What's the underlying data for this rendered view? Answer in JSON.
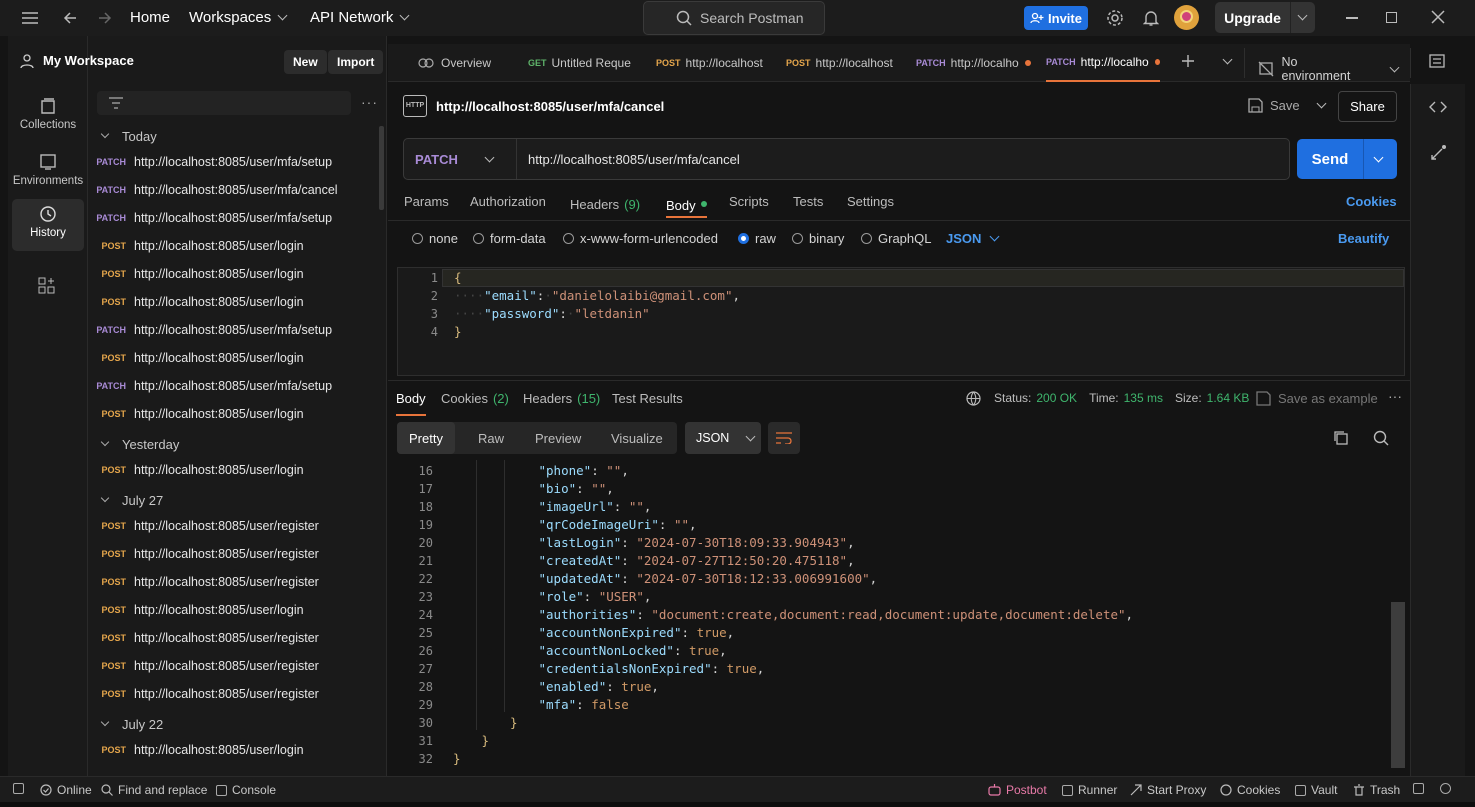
{
  "topbar": {
    "home": "Home",
    "workspaces": "Workspaces",
    "api_network": "API Network",
    "search_placeholder": "Search Postman",
    "invite": "Invite",
    "upgrade": "Upgrade"
  },
  "rail": {
    "collections": "Collections",
    "environments": "Environments",
    "history": "History"
  },
  "sidebar": {
    "workspace": "My Workspace",
    "new": "New",
    "import": "Import",
    "groups": [
      {
        "title": "Today",
        "items": [
          {
            "method": "PATCH",
            "url": "http://localhost:8085/user/mfa/setup"
          },
          {
            "method": "PATCH",
            "url": "http://localhost:8085/user/mfa/cancel"
          },
          {
            "method": "PATCH",
            "url": "http://localhost:8085/user/mfa/setup"
          },
          {
            "method": "POST",
            "url": "http://localhost:8085/user/login"
          },
          {
            "method": "POST",
            "url": "http://localhost:8085/user/login"
          },
          {
            "method": "POST",
            "url": "http://localhost:8085/user/login"
          },
          {
            "method": "PATCH",
            "url": "http://localhost:8085/user/mfa/setup"
          },
          {
            "method": "POST",
            "url": "http://localhost:8085/user/login"
          },
          {
            "method": "PATCH",
            "url": "http://localhost:8085/user/mfa/setup"
          },
          {
            "method": "POST",
            "url": "http://localhost:8085/user/login"
          }
        ]
      },
      {
        "title": "Yesterday",
        "items": [
          {
            "method": "POST",
            "url": "http://localhost:8085/user/login"
          }
        ]
      },
      {
        "title": "July 27",
        "items": [
          {
            "method": "POST",
            "url": "http://localhost:8085/user/register"
          },
          {
            "method": "POST",
            "url": "http://localhost:8085/user/register"
          },
          {
            "method": "POST",
            "url": "http://localhost:8085/user/register"
          },
          {
            "method": "POST",
            "url": "http://localhost:8085/user/login"
          },
          {
            "method": "POST",
            "url": "http://localhost:8085/user/register"
          },
          {
            "method": "POST",
            "url": "http://localhost:8085/user/register"
          },
          {
            "method": "POST",
            "url": "http://localhost:8085/user/register"
          }
        ]
      },
      {
        "title": "July 22",
        "items": [
          {
            "method": "POST",
            "url": "http://localhost:8085/user/login"
          }
        ]
      }
    ]
  },
  "tabs": [
    {
      "method": "",
      "label": "Overview"
    },
    {
      "method": "GET",
      "label": "Untitled Reques"
    },
    {
      "method": "POST",
      "label": "http://localhost"
    },
    {
      "method": "POST",
      "label": "http://localhost"
    },
    {
      "method": "PATCH",
      "label": "http://localho"
    },
    {
      "method": "PATCH",
      "label": "http://localho"
    }
  ],
  "environment": "No environment",
  "request": {
    "title": "http://localhost:8085/user/mfa/cancel",
    "save": "Save",
    "share": "Share",
    "method": "PATCH",
    "url": "http://localhost:8085/user/mfa/cancel",
    "send": "Send",
    "subtabs": {
      "params": "Params",
      "authorization": "Authorization",
      "headers": "Headers",
      "headers_count": "(9)",
      "body": "Body",
      "scripts": "Scripts",
      "tests": "Tests",
      "settings": "Settings",
      "cookies": "Cookies"
    },
    "body_types": {
      "none": "none",
      "form_data": "form-data",
      "urlencoded": "x-www-form-urlencoded",
      "raw": "raw",
      "binary": "binary",
      "graphql": "GraphQL",
      "json": "JSON",
      "beautify": "Beautify"
    },
    "body_lines": [
      {
        "n": "1",
        "text": "{"
      },
      {
        "n": "2",
        "key": "\"email\"",
        "val": "\"danielolaibi@gmail.com\"",
        "tail": ","
      },
      {
        "n": "3",
        "key": "\"password\"",
        "val": "\"letdanin\"",
        "tail": ""
      },
      {
        "n": "4",
        "text": "}"
      }
    ]
  },
  "response": {
    "tabs": {
      "body": "Body",
      "cookies": "Cookies",
      "cookies_count": "(2)",
      "headers": "Headers",
      "headers_count": "(15)",
      "test_results": "Test Results"
    },
    "status_label": "Status:",
    "status": "200 OK",
    "time_label": "Time:",
    "time": "135 ms",
    "size_label": "Size:",
    "size": "1.64 KB",
    "save_example": "Save as example",
    "views": {
      "pretty": "Pretty",
      "raw": "Raw",
      "preview": "Preview",
      "visualize": "Visualize",
      "format": "JSON"
    },
    "lines": [
      {
        "n": "16",
        "indent": 2,
        "key": "\"phone\"",
        "val": "\"\"",
        "type": "s",
        "tail": ","
      },
      {
        "n": "17",
        "indent": 2,
        "key": "\"bio\"",
        "val": "\"\"",
        "type": "s",
        "tail": ","
      },
      {
        "n": "18",
        "indent": 2,
        "key": "\"imageUrl\"",
        "val": "\"\"",
        "type": "s",
        "tail": ","
      },
      {
        "n": "19",
        "indent": 2,
        "key": "\"qrCodeImageUri\"",
        "val": "\"\"",
        "type": "s",
        "tail": ","
      },
      {
        "n": "20",
        "indent": 2,
        "key": "\"lastLogin\"",
        "val": "\"2024-07-30T18:09:33.904943\"",
        "type": "s",
        "tail": ","
      },
      {
        "n": "21",
        "indent": 2,
        "key": "\"createdAt\"",
        "val": "\"2024-07-27T12:50:20.475118\"",
        "type": "s",
        "tail": ","
      },
      {
        "n": "22",
        "indent": 2,
        "key": "\"updatedAt\"",
        "val": "\"2024-07-30T18:12:33.006991600\"",
        "type": "s",
        "tail": ","
      },
      {
        "n": "23",
        "indent": 2,
        "key": "\"role\"",
        "val": "\"USER\"",
        "type": "s",
        "tail": ","
      },
      {
        "n": "24",
        "indent": 2,
        "key": "\"authorities\"",
        "val": "\"document:create,document:read,document:update,document:delete\"",
        "type": "s",
        "tail": ","
      },
      {
        "n": "25",
        "indent": 2,
        "key": "\"accountNonExpired\"",
        "val": "true",
        "type": "t",
        "tail": ","
      },
      {
        "n": "26",
        "indent": 2,
        "key": "\"accountNonLocked\"",
        "val": "true",
        "type": "t",
        "tail": ","
      },
      {
        "n": "27",
        "indent": 2,
        "key": "\"credentialsNonExpired\"",
        "val": "true",
        "type": "t",
        "tail": ","
      },
      {
        "n": "28",
        "indent": 2,
        "key": "\"enabled\"",
        "val": "true",
        "type": "t",
        "tail": ","
      },
      {
        "n": "29",
        "indent": 2,
        "key": "\"mfa\"",
        "val": "false",
        "type": "t",
        "tail": ""
      },
      {
        "n": "30",
        "indent": 1,
        "text": "}"
      },
      {
        "n": "31",
        "indent": 0,
        "text": "}"
      },
      {
        "n": "32",
        "indent": -1,
        "text": "}"
      }
    ]
  },
  "statusbar": {
    "online": "Online",
    "find_replace": "Find and replace",
    "console": "Console",
    "postbot": "Postbot",
    "runner": "Runner",
    "start_proxy": "Start Proxy",
    "cookies": "Cookies",
    "vault": "Vault",
    "trash": "Trash"
  }
}
